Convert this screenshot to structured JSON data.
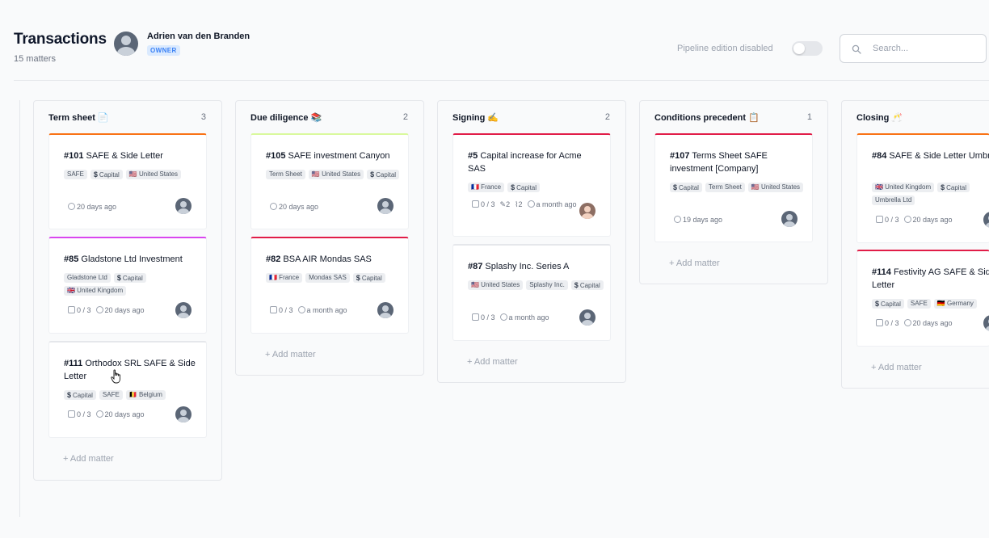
{
  "header": {
    "title": "Transactions",
    "count": "15 matters",
    "user_name": "Adrien van den Branden",
    "user_role": "OWNER",
    "pipeline_label": "Pipeline edition disabled",
    "pipeline_enabled": false,
    "search_placeholder": "Search..."
  },
  "columns": [
    {
      "title": "Term sheet 📄",
      "count": "3",
      "add_label": "+ Add matter",
      "cards": [
        {
          "id": "#101",
          "name": "SAFE & Side Letter",
          "accent": "#f97316",
          "tags": [
            "SAFE",
            "$ Capital",
            "🇺🇸 United States"
          ],
          "meta": [
            "20 days ago"
          ]
        },
        {
          "id": "#85",
          "name": "Gladstone Ltd Investment",
          "accent": "#d946ef",
          "tags": [
            "Gladstone Ltd",
            "$ Capital",
            "🇬🇧 United Kingdom"
          ],
          "meta": [
            "0 / 3",
            "20 days ago"
          ]
        },
        {
          "id": "#111",
          "name": "Orthodox SRL SAFE & Side Letter",
          "accent": "#e5e7eb",
          "tags": [
            "$ Capital",
            "SAFE",
            "🇧🇪 Belgium"
          ],
          "meta": [
            "0 / 3",
            "20 days ago"
          ]
        }
      ]
    },
    {
      "title": "Due diligence 📚",
      "count": "2",
      "add_label": "+ Add matter",
      "cards": [
        {
          "id": "#105",
          "name": "SAFE investment Canyon",
          "accent": "#d9f99d",
          "tags": [
            "Term Sheet",
            "🇺🇸 United States",
            "$ Capital"
          ],
          "meta": [
            "20 days ago"
          ]
        },
        {
          "id": "#82",
          "name": "BSA AIR Mondas SAS",
          "accent": "#e11d48",
          "tags": [
            "🇫🇷 France",
            "Mondas SAS",
            "$ Capital"
          ],
          "meta": [
            "0 / 3",
            "a month ago"
          ]
        }
      ]
    },
    {
      "title": "Signing ✍️",
      "count": "2",
      "add_label": "+ Add matter",
      "cards": [
        {
          "id": "#5",
          "name": "Capital increase for Acme SAS",
          "accent": "#e11d48",
          "tags": [
            "🇫🇷 France",
            "$ Capital"
          ],
          "meta": [
            "0 / 3",
            "2",
            "2",
            "a month ago"
          ]
        },
        {
          "id": "#87",
          "name": "Splashy Inc. Series A",
          "accent": "#e5e7eb",
          "tags": [
            "🇺🇸 United States",
            "Splashy Inc.",
            "$ Capital"
          ],
          "meta": [
            "0 / 3",
            "a month ago"
          ]
        }
      ]
    },
    {
      "title": "Conditions precedent 📋",
      "count": "1",
      "add_label": "+ Add matter",
      "cards": [
        {
          "id": "#107",
          "name": "Terms Sheet SAFE investment [Company]",
          "accent": "#e11d48",
          "tags": [
            "$ Capital",
            "Term Sheet",
            "🇺🇸 United States"
          ],
          "meta": [
            "19 days ago"
          ]
        }
      ]
    },
    {
      "title": "Closing 🥂",
      "count": "",
      "add_label": "+ Add matter",
      "cards": [
        {
          "id": "#84",
          "name": "SAFE & Side Letter Umbrella",
          "accent": "#f97316",
          "tags": [
            "🇬🇧 United Kingdom",
            "$ Capital",
            "Umbrella Ltd"
          ],
          "meta": [
            "0 / 3",
            "20 days ago"
          ]
        },
        {
          "id": "#114",
          "name": "Festivity AG SAFE & Side Letter",
          "accent": "#e11d48",
          "tags": [
            "$ Capital",
            "SAFE",
            "🇩🇪 Germany"
          ],
          "meta": [
            "0 / 3",
            "20 days ago"
          ]
        }
      ]
    }
  ]
}
